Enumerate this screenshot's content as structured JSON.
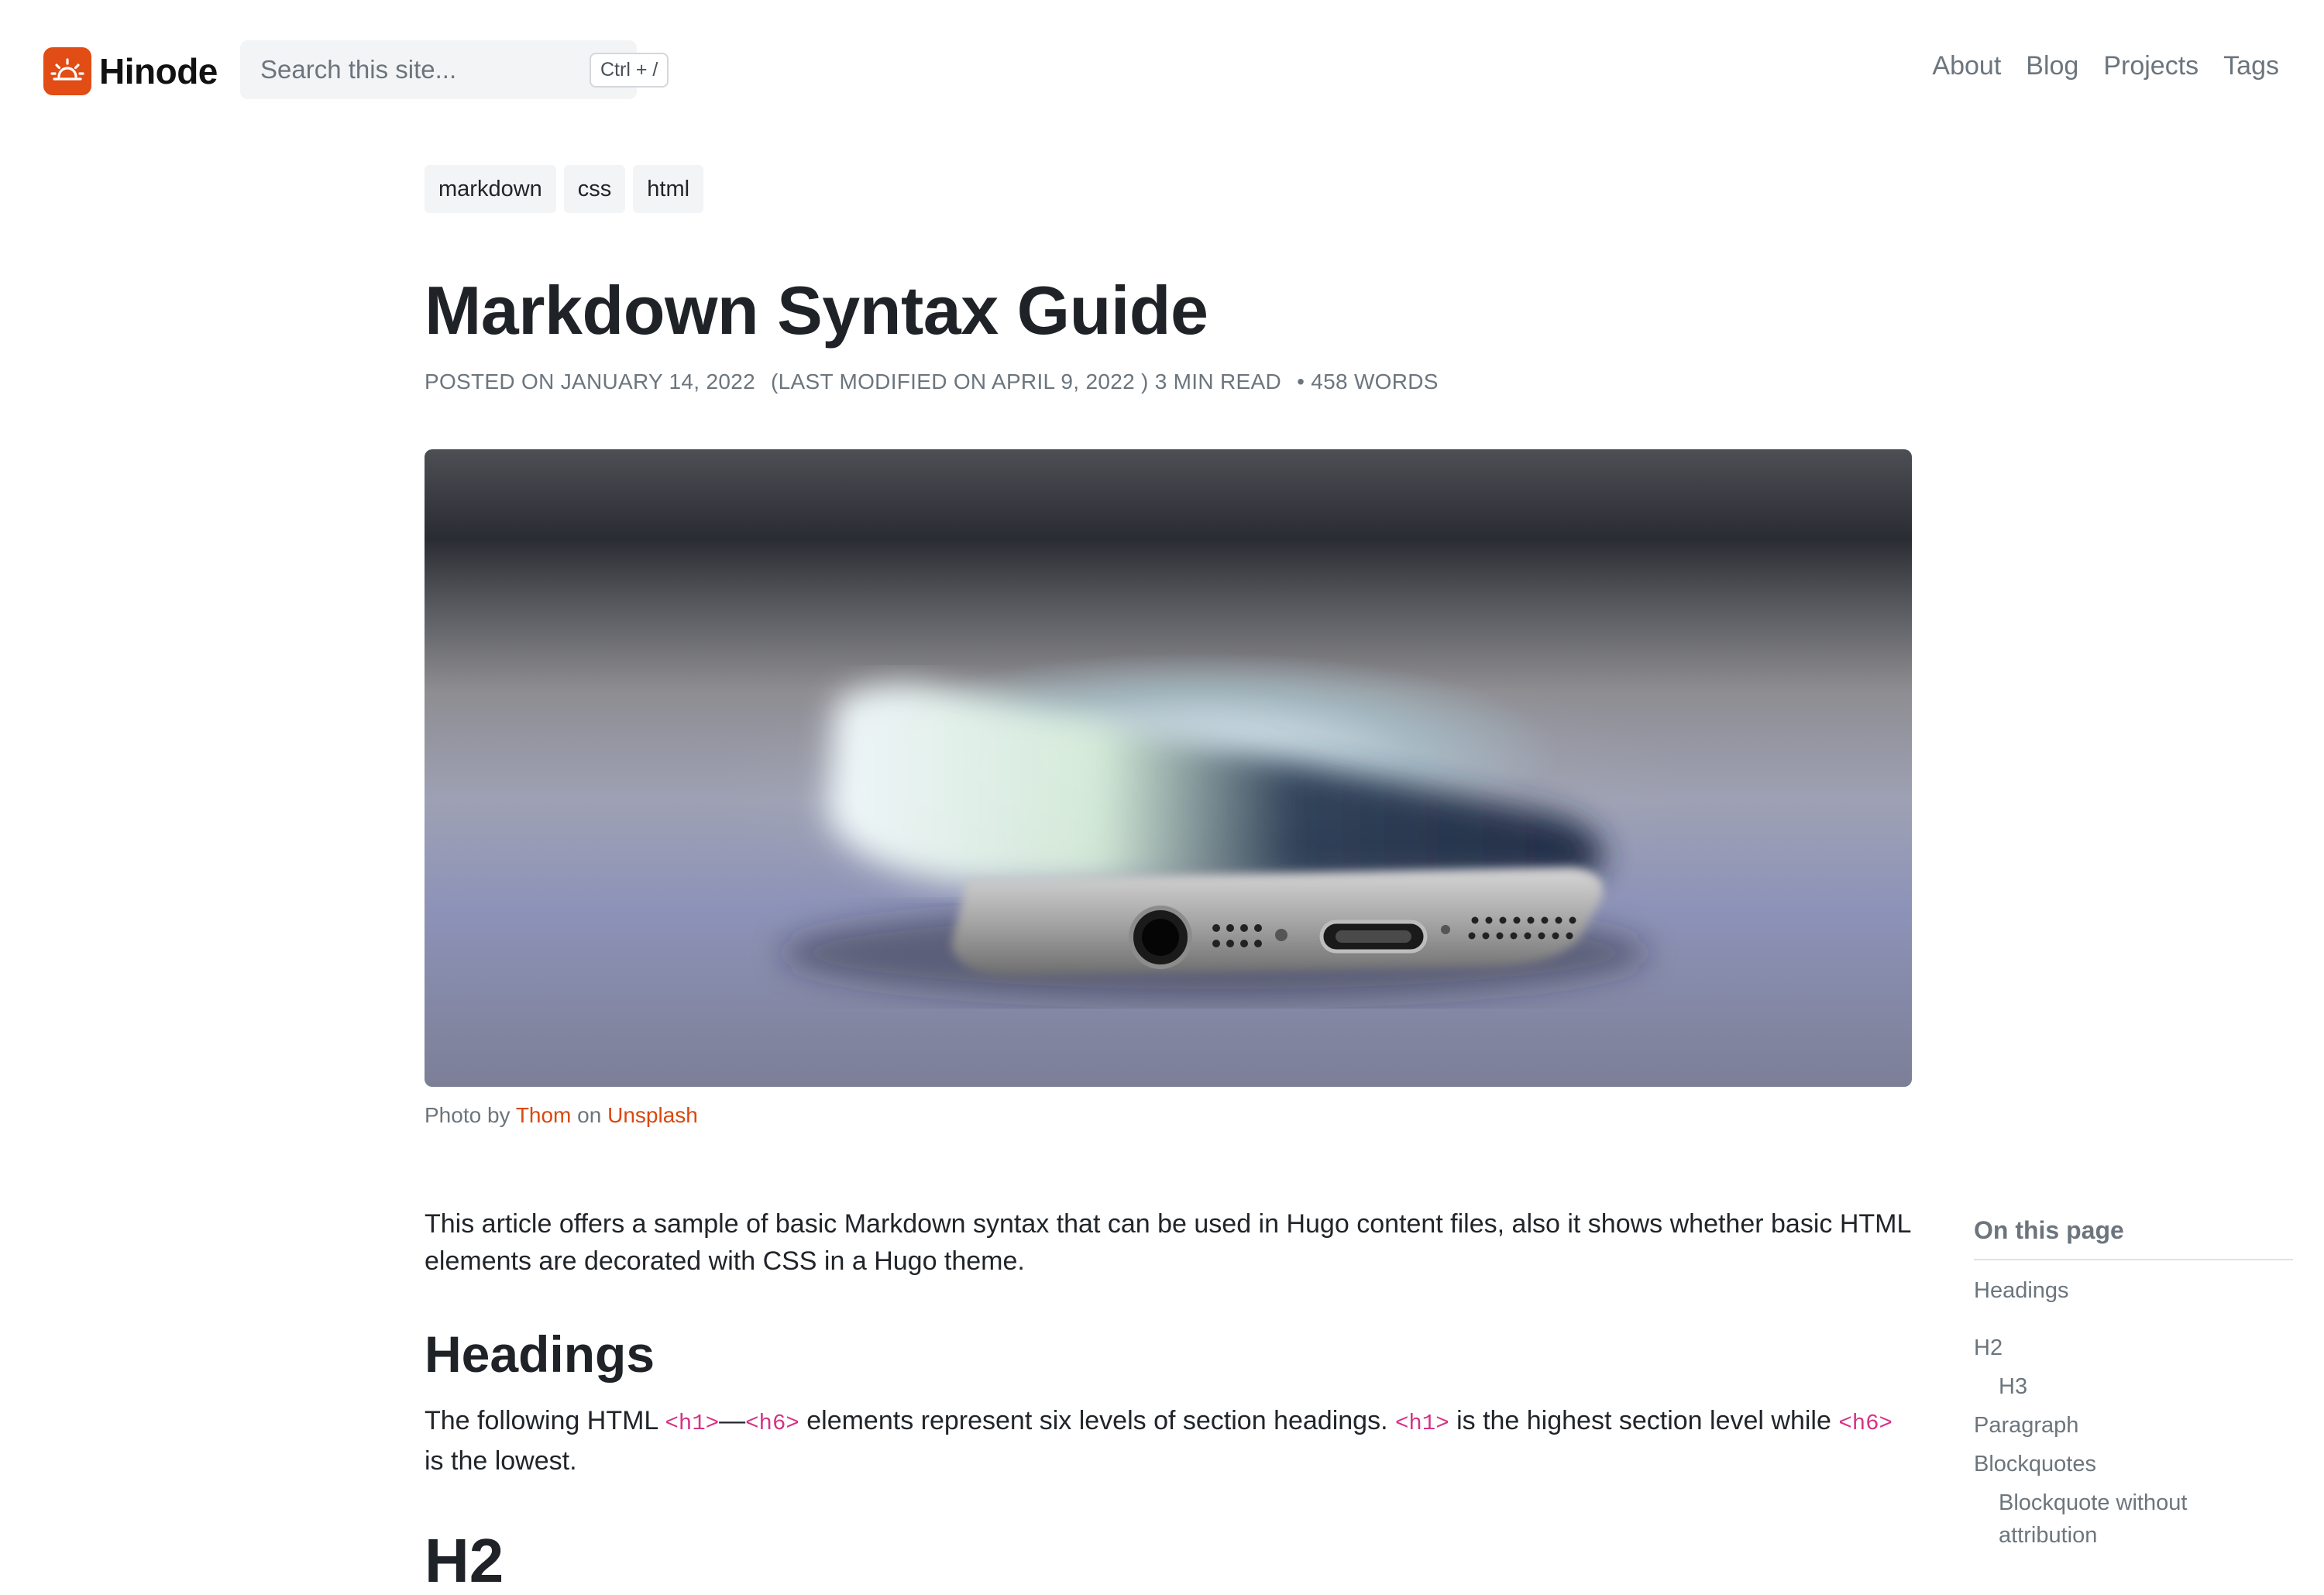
{
  "site": {
    "brand": "Hinode",
    "logo_icon": "sunrise-icon",
    "accent_color": "#e24c15"
  },
  "search": {
    "placeholder": "Search this site...",
    "shortcut": "Ctrl + /"
  },
  "nav": {
    "items": [
      "About",
      "Blog",
      "Projects",
      "Tags"
    ]
  },
  "post": {
    "tags": [
      "markdown",
      "css",
      "html"
    ],
    "title": "Markdown Syntax Guide",
    "meta": {
      "posted": "POSTED ON JANUARY 14, 2022",
      "modified": "(LAST MODIFIED ON APRIL 9, 2022 ) 3 MIN READ",
      "words": "• 458 WORDS"
    },
    "caption": {
      "prefix": "Photo by",
      "author": "Thom",
      "on": "on",
      "source": "Unsplash"
    },
    "intro": "This article offers a sample of basic Markdown syntax that can be used in Hugo content files, also it shows whether basic HTML elements are decorated with CSS in a Hugo theme.",
    "headings_title": "Headings",
    "headings_text": {
      "t1": "The following HTML",
      "c1": "<h1>",
      "dash": "—",
      "c2": "<h6>",
      "t2": "elements represent six levels of section headings.",
      "c3": "<h1>",
      "t3": "is the highest section level while",
      "c4": "<h6>",
      "t4": "is the lowest."
    },
    "next_heading_peek": "H2"
  },
  "toc": {
    "title": "On this page",
    "items": [
      {
        "label": "Headings",
        "level": 1
      },
      {
        "label": "H2",
        "level": 1
      },
      {
        "label": "H3",
        "level": 2
      },
      {
        "label": "Paragraph",
        "level": 1
      },
      {
        "label": "Blockquotes",
        "level": 1
      },
      {
        "label": "Blockquote without attribution",
        "level": 2
      }
    ]
  }
}
